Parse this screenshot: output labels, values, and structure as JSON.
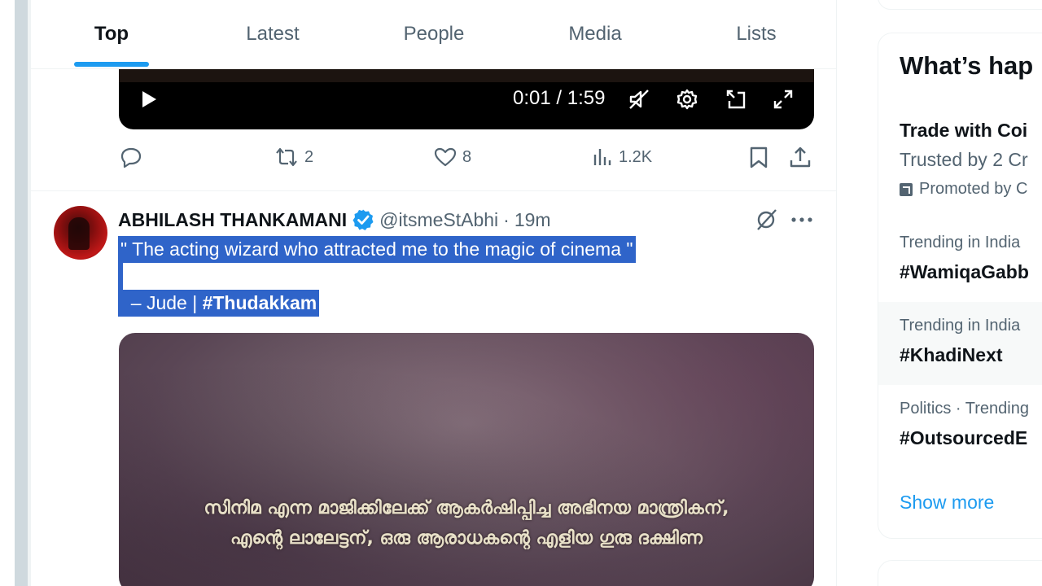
{
  "tabs": [
    {
      "label": "Top",
      "active": true
    },
    {
      "label": "Latest",
      "active": false
    },
    {
      "label": "People",
      "active": false
    },
    {
      "label": "Media",
      "active": false
    },
    {
      "label": "Lists",
      "active": false
    }
  ],
  "video": {
    "time": "0:01 / 1:59",
    "controls": [
      "play-icon",
      "mute-icon",
      "settings-icon",
      "picture-in-picture-icon",
      "fullscreen-icon"
    ]
  },
  "prev_tweet_actions": {
    "reply_count": "",
    "retweet_count": "2",
    "like_count": "8",
    "views_count": "1.2K"
  },
  "tweet": {
    "name": "ABHILASH THANKAMANI",
    "verified": true,
    "handle": "@itsmeStAbhi",
    "separator": "·",
    "time": "19m",
    "text_line1": "\" The acting wizard who attracted me to the magic of cinema \"",
    "text_line3_prefix": "  – Jude | ",
    "hashtag": "#Thudakkam",
    "image_caption_line1": "സിനിമ എന്ന മാജിക്കിലേക്ക് ആകർഷിപ്പിച്ച അഭിനയ മാന്ത്രികന്,",
    "image_caption_line2": "എന്റെ ലാലേട്ടന്, ഒരു ആരാധകന്റെ എളിയ ഗുരു ദക്ഷിണ"
  },
  "sidebar": {
    "title": "What’s hap",
    "promo": {
      "title": "Trade with Coi",
      "subtitle": "Trusted by 2 Cr",
      "promoted_by": "Promoted by C"
    },
    "trends": [
      {
        "context": "Trending in India",
        "name": "#WamiqaGabb"
      },
      {
        "context": "Trending in India",
        "name": "#KhadiNext"
      },
      {
        "context": "Politics · Trending",
        "name": "#OutsourcedE"
      }
    ],
    "show_more": "Show more"
  },
  "colors": {
    "accent": "#1d9bf0",
    "text_primary": "#0f1419",
    "text_secondary": "#536471",
    "selection": "#2f64c9"
  }
}
